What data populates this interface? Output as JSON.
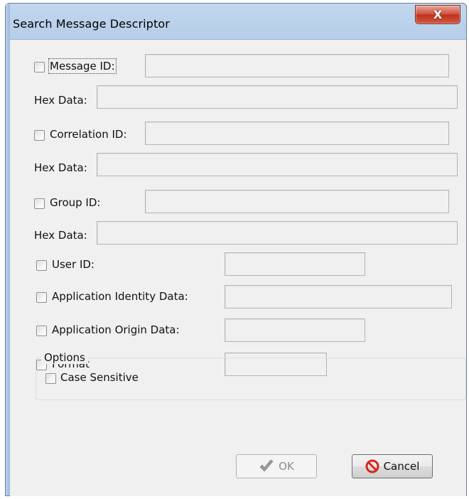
{
  "window": {
    "title": "Search Message Descriptor",
    "close_glyph": "X"
  },
  "fields": {
    "message_id": {
      "label": "Message ID:",
      "value": ""
    },
    "message_hex": {
      "label": "Hex Data:",
      "value": ""
    },
    "correlation_id": {
      "label": "Correlation ID:",
      "value": ""
    },
    "correlation_hex": {
      "label": "Hex Data:",
      "value": ""
    },
    "group_id": {
      "label": "Group ID:",
      "value": ""
    },
    "group_hex": {
      "label": "Hex Data:",
      "value": ""
    },
    "user_id": {
      "label": "User ID:",
      "value": ""
    },
    "app_identity": {
      "label": "Application Identity Data:",
      "value": ""
    },
    "app_origin": {
      "label": "Application Origin Data:",
      "value": ""
    },
    "format": {
      "label": "Format",
      "value": ""
    }
  },
  "options": {
    "title": "Options",
    "case_sensitive_label": "Case Sensitive"
  },
  "buttons": {
    "ok_label": "OK",
    "ok_enabled": false,
    "ok_icon": "checkmark-icon",
    "cancel_label": "Cancel",
    "cancel_icon": "no-entry-icon"
  },
  "colors": {
    "close_button": "#c7432f",
    "cancel_icon": "#d8261c",
    "ok_icon_disabled": "#9a9a9a"
  }
}
